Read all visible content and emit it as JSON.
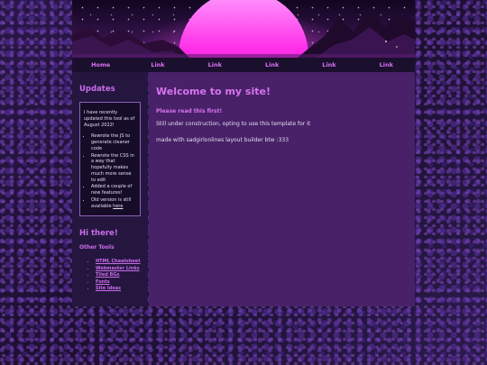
{
  "nav": {
    "items": [
      "Home",
      "Link",
      "Link",
      "Link",
      "Link",
      "Link"
    ]
  },
  "sidebar": {
    "updates_title": "Updates",
    "updates_intro": "I have recently updated this tool as of August 2022!",
    "updates_list": [
      "Rewrote the JS to generate cleaner code",
      "Rewrote the CSS in a way that hopefully makes much more sense to edit",
      "Added a couple of new features!"
    ],
    "updates_last_prefix": "Old version is still available",
    "updates_last_link": "here",
    "hi_title": "Hi there!",
    "tools_title": "Other Tools",
    "tools": [
      "HTML Cheatsheet",
      "Webmaster Links",
      "Tiled BGs",
      "Fonts",
      "Site Ideas"
    ]
  },
  "main": {
    "title": "Welcome to my site!",
    "subtitle": "Please read this first!",
    "para1": "Still under construction, opting to use this template for it",
    "para2": "made with sadgirlonlines layout builder btw :333"
  },
  "colors": {
    "accent": "#d774f0",
    "main_bg": "#482168",
    "sidebar_bg": "#251640",
    "nav_bg": "#1b0f2e"
  }
}
